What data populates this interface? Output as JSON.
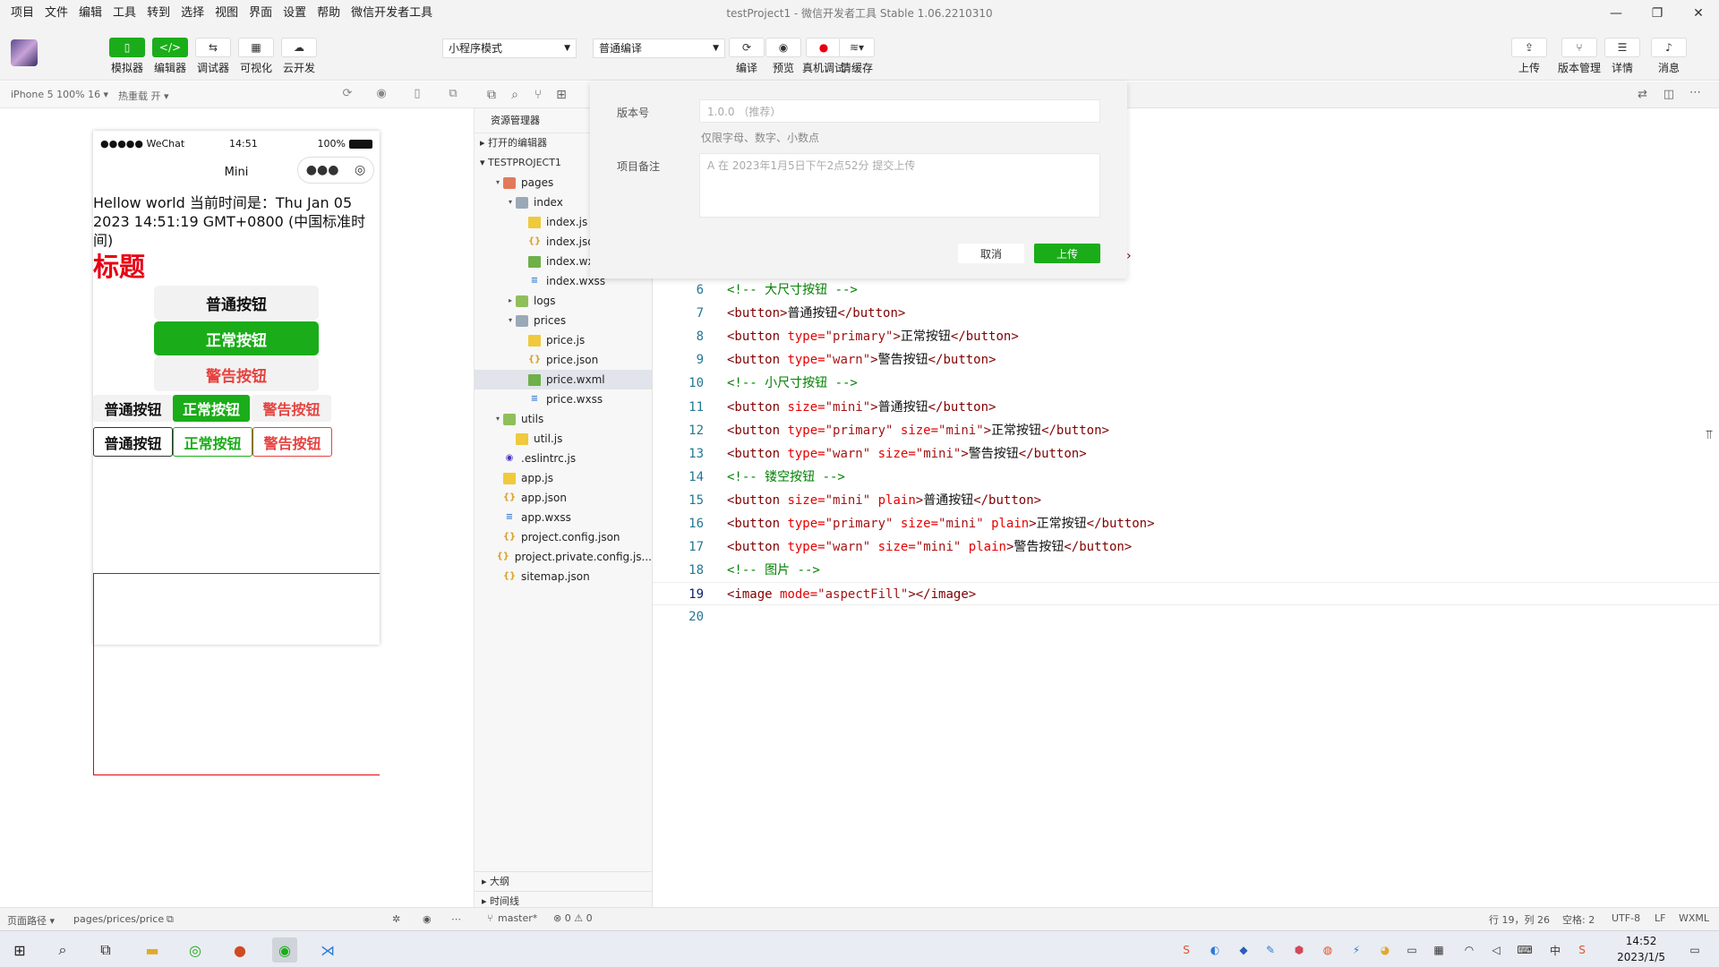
{
  "menu": [
    "项目",
    "文件",
    "编辑",
    "工具",
    "转到",
    "选择",
    "视图",
    "界面",
    "设置",
    "帮助",
    "微信开发者工具"
  ],
  "window_title": "testProject1 - 微信开发者工具 Stable 1.06.2210310",
  "toolbar": {
    "left": [
      {
        "label": "模拟器",
        "icon": "phone-icon",
        "glyph": "▯",
        "active": true
      },
      {
        "label": "编辑器",
        "icon": "code-icon",
        "glyph": "</>",
        "active": true
      },
      {
        "label": "调试器",
        "icon": "debug-icon",
        "glyph": "⇆",
        "active": false
      },
      {
        "label": "可视化",
        "icon": "layout-icon",
        "glyph": "▦",
        "active": false
      },
      {
        "label": "云开发",
        "icon": "cloud-icon",
        "glyph": "☁",
        "active": false
      }
    ],
    "mode_select": "小程序模式",
    "compile_select": "普通编译",
    "middle": [
      {
        "label": "编译",
        "icon": "refresh-icon",
        "glyph": "⟳"
      },
      {
        "label": "预览",
        "icon": "eye-icon",
        "glyph": "◉"
      },
      {
        "label": "真机调试",
        "icon": "record-icon",
        "glyph": "●"
      },
      {
        "label": "清缓存",
        "icon": "layers-icon",
        "glyph": "≋▾"
      }
    ],
    "right": [
      {
        "label": "上传",
        "icon": "upload-icon",
        "glyph": "⇪"
      },
      {
        "label": "版本管理",
        "icon": "branch-icon",
        "glyph": "⑂"
      },
      {
        "label": "详情",
        "icon": "menu-icon",
        "glyph": "☰"
      },
      {
        "label": "消息",
        "icon": "bell-icon",
        "glyph": "♪"
      }
    ]
  },
  "simbar": {
    "device": "iPhone 5 100% 16 ▾",
    "hotreload": "热重载 开 ▾"
  },
  "phone": {
    "carrier": "●●●●● WeChat",
    "time": "14:51",
    "battery": "100%",
    "nav_title": "Mini",
    "text": "Hellow world 当前时间是：Thu Jan 05 2023 14:51:19 GMT+0800 (中国标准时间)",
    "title": "标题",
    "big_buttons": [
      "普通按钮",
      "正常按钮",
      "警告按钮"
    ],
    "mini_buttons": [
      "普通按钮",
      "正常按钮",
      "警告按钮"
    ],
    "plain_buttons": [
      "普通按钮",
      "正常按钮",
      "警告按钮"
    ]
  },
  "explorer": {
    "header": "资源管理器",
    "open_editors": "打开的编辑器",
    "project": "TESTPROJECT1",
    "tree": [
      {
        "name": "pages",
        "level": 1,
        "type": "folder-red",
        "arrow": "▾"
      },
      {
        "name": "index",
        "level": 2,
        "type": "folder-blue",
        "arrow": "▾"
      },
      {
        "name": "index.js",
        "level": 3,
        "type": "js"
      },
      {
        "name": "index.json",
        "level": 3,
        "type": "json"
      },
      {
        "name": "index.wxml",
        "level": 3,
        "type": "wxml"
      },
      {
        "name": "index.wxss",
        "level": 3,
        "type": "wxss"
      },
      {
        "name": "logs",
        "level": 2,
        "type": "folder-green",
        "arrow": "▸"
      },
      {
        "name": "prices",
        "level": 2,
        "type": "folder-blue",
        "arrow": "▾"
      },
      {
        "name": "price.js",
        "level": 3,
        "type": "js"
      },
      {
        "name": "price.json",
        "level": 3,
        "type": "json"
      },
      {
        "name": "price.wxml",
        "level": 3,
        "type": "wxml",
        "selected": true
      },
      {
        "name": "price.wxss",
        "level": 3,
        "type": "wxss"
      },
      {
        "name": "utils",
        "level": 1,
        "type": "folder-green",
        "arrow": "▾"
      },
      {
        "name": "util.js",
        "level": 2,
        "type": "js"
      },
      {
        "name": ".eslintrc.js",
        "level": 1,
        "type": "eslint"
      },
      {
        "name": "app.js",
        "level": 1,
        "type": "js"
      },
      {
        "name": "app.json",
        "level": 1,
        "type": "json"
      },
      {
        "name": "app.wxss",
        "level": 1,
        "type": "wxss"
      },
      {
        "name": "project.config.json",
        "level": 1,
        "type": "json"
      },
      {
        "name": "project.private.config.js...",
        "level": 1,
        "type": "json"
      },
      {
        "name": "sitemap.json",
        "level": 1,
        "type": "json"
      }
    ],
    "outline": "大纲",
    "timeline": "时间线"
  },
  "dialog": {
    "version_label": "版本号",
    "version_placeholder": "1.0.0 （推荐）",
    "version_hint": "仅限字母、数字、小数点",
    "note_label": "项目备注",
    "note_placeholder": "A 在 2023年1月5日下午2点52分 提交上传",
    "cancel": "取消",
    "upload": "上传"
  },
  "code": [
    {
      "n": "6",
      "parts": [
        [
          "cm",
          "<!-- 大尺寸按钮 -->"
        ]
      ]
    },
    {
      "n": "7",
      "parts": [
        [
          "tag",
          "<button>"
        ],
        [
          "txt",
          "普通按钮"
        ],
        [
          "tag",
          "</button>"
        ]
      ]
    },
    {
      "n": "8",
      "parts": [
        [
          "tag",
          "<button "
        ],
        [
          "attr",
          "type="
        ],
        [
          "val",
          "\"primary\""
        ],
        [
          "tag",
          ">"
        ],
        [
          "txt",
          "正常按钮"
        ],
        [
          "tag",
          "</button>"
        ]
      ]
    },
    {
      "n": "9",
      "parts": [
        [
          "tag",
          "<button "
        ],
        [
          "attr",
          "type="
        ],
        [
          "val",
          "\"warn\""
        ],
        [
          "tag",
          ">"
        ],
        [
          "txt",
          "警告按钮"
        ],
        [
          "tag",
          "</button>"
        ]
      ]
    },
    {
      "n": "10",
      "parts": [
        [
          "cm",
          "<!-- 小尺寸按钮 -->"
        ]
      ]
    },
    {
      "n": "11",
      "parts": [
        [
          "tag",
          "<button "
        ],
        [
          "attr",
          "size="
        ],
        [
          "val",
          "\"mini\""
        ],
        [
          "tag",
          ">"
        ],
        [
          "txt",
          "普通按钮"
        ],
        [
          "tag",
          "</button>"
        ]
      ]
    },
    {
      "n": "12",
      "parts": [
        [
          "tag",
          "<button "
        ],
        [
          "attr",
          "type="
        ],
        [
          "val",
          "\"primary\" "
        ],
        [
          "attr",
          "size="
        ],
        [
          "val",
          "\"mini\""
        ],
        [
          "tag",
          ">"
        ],
        [
          "txt",
          "正常按钮"
        ],
        [
          "tag",
          "</button>"
        ]
      ]
    },
    {
      "n": "13",
      "parts": [
        [
          "tag",
          "<button "
        ],
        [
          "attr",
          "type="
        ],
        [
          "val",
          "\"warn\" "
        ],
        [
          "attr",
          "size="
        ],
        [
          "val",
          "\"mini\""
        ],
        [
          "tag",
          ">"
        ],
        [
          "txt",
          "警告按钮"
        ],
        [
          "tag",
          "</button>"
        ]
      ]
    },
    {
      "n": "14",
      "parts": [
        [
          "cm",
          "<!-- 镂空按钮 -->"
        ]
      ]
    },
    {
      "n": "15",
      "parts": [
        [
          "tag",
          "<button "
        ],
        [
          "attr",
          "size="
        ],
        [
          "val",
          "\"mini\" "
        ],
        [
          "attr",
          "plain"
        ],
        [
          "tag",
          ">"
        ],
        [
          "txt",
          "普通按钮"
        ],
        [
          "tag",
          "</button>"
        ]
      ]
    },
    {
      "n": "16",
      "parts": [
        [
          "tag",
          "<button "
        ],
        [
          "attr",
          "type="
        ],
        [
          "val",
          "\"primary\" "
        ],
        [
          "attr",
          "size="
        ],
        [
          "val",
          "\"mini\" "
        ],
        [
          "attr",
          "plain"
        ],
        [
          "tag",
          ">"
        ],
        [
          "txt",
          "正常按钮"
        ],
        [
          "tag",
          "</button>"
        ]
      ]
    },
    {
      "n": "17",
      "parts": [
        [
          "tag",
          "<button "
        ],
        [
          "attr",
          "type="
        ],
        [
          "val",
          "\"warn\" "
        ],
        [
          "attr",
          "size="
        ],
        [
          "val",
          "\"mini\" "
        ],
        [
          "attr",
          "plain"
        ],
        [
          "tag",
          ">"
        ],
        [
          "txt",
          "警告按钮"
        ],
        [
          "tag",
          "</button>"
        ]
      ]
    },
    {
      "n": "18",
      "parts": [
        [
          "cm",
          "<!-- 图片 -->"
        ]
      ]
    },
    {
      "n": "19",
      "parts": [
        [
          "tag",
          "<image "
        ],
        [
          "attr",
          "mode="
        ],
        [
          "val",
          "\"aspectFill\""
        ],
        [
          "tag",
          "></image>"
        ]
      ],
      "current": true
    },
    {
      "n": "20",
      "parts": []
    }
  ],
  "status": {
    "page_path_label": "页面路径 ▾",
    "page_path": "pages/prices/price",
    "branch": "master*",
    "problems": "⊗ 0 ⚠ 0",
    "cursor": "行 19，列 26",
    "spaces": "空格: 2",
    "encoding": "UTF-8",
    "eol": "LF",
    "lang": "WXML"
  },
  "taskbar": {
    "time": "14:52",
    "date": "2023/1/5",
    "ime": "中"
  }
}
